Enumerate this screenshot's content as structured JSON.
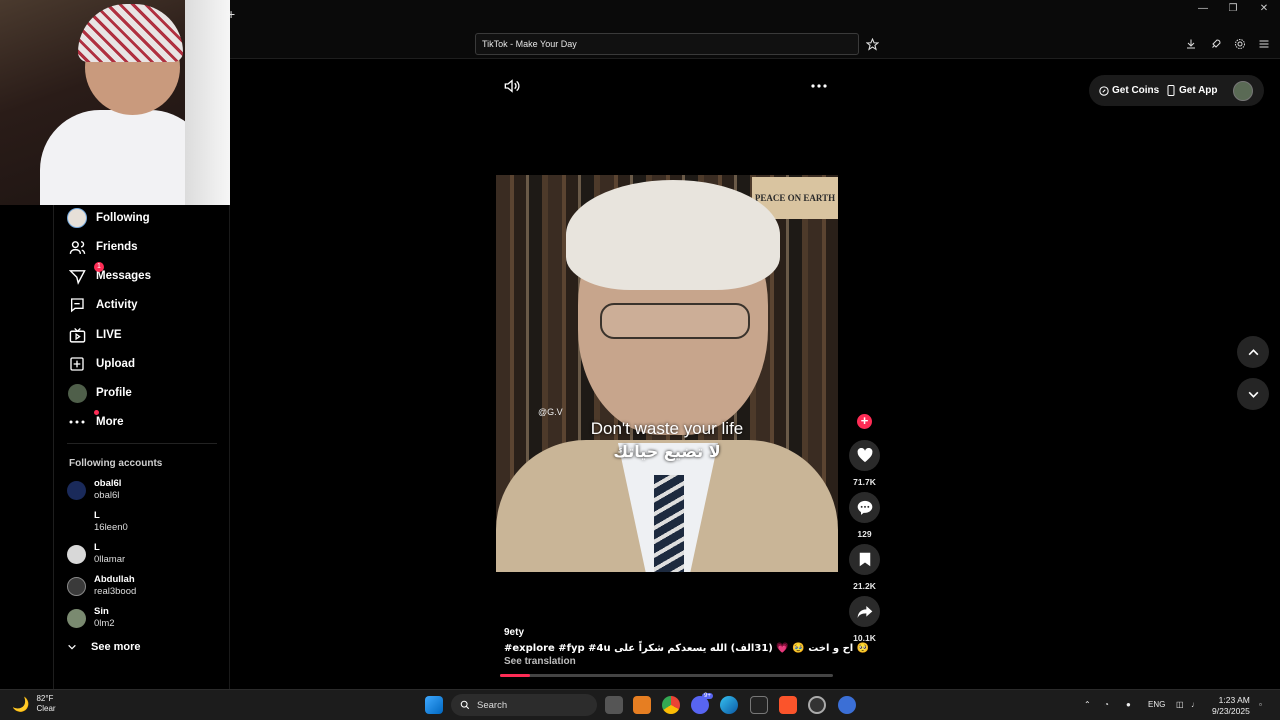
{
  "browser": {
    "tab_title": "TikTok - Make Your Day",
    "new_tab_glyph": "+",
    "toolbar_icons": [
      "bookmark-star-icon",
      "download-icon",
      "rocket-icon",
      "settings-icon",
      "menu-icon"
    ],
    "window_controls": [
      "minimize",
      "restore",
      "close"
    ]
  },
  "sidebar": {
    "items": [
      {
        "label": "Following",
        "icon": "following-avatar-icon"
      },
      {
        "label": "Friends",
        "icon": "friends-icon"
      },
      {
        "label": "Messages",
        "icon": "messages-icon",
        "badge": "1"
      },
      {
        "label": "Activity",
        "icon": "activity-icon"
      },
      {
        "label": "LIVE",
        "icon": "live-icon"
      },
      {
        "label": "Upload",
        "icon": "upload-icon"
      },
      {
        "label": "Profile",
        "icon": "profile-avatar-icon"
      },
      {
        "label": "More",
        "icon": "more-dots-icon"
      }
    ],
    "following_title": "Following accounts",
    "accounts": [
      {
        "name": "obal6l",
        "handle": "obal6l",
        "avatar_color": "#1a2a5a"
      },
      {
        "name": "L",
        "handle": "16leen0",
        "avatar_color": "#000000"
      },
      {
        "name": "L",
        "handle": "0llamar",
        "avatar_color": "#d8d8d8"
      },
      {
        "name": "Abdullah",
        "handle": "real3bood",
        "avatar_color": "#3a3a3a"
      },
      {
        "name": "Sin",
        "handle": "0lm2",
        "avatar_color": "#7a8a70"
      }
    ],
    "see_more": "See more"
  },
  "video": {
    "poster_text": "PEACE ON EARTH",
    "watermark": "@G.V",
    "caption_en": "Don't waste your life",
    "caption_ar": "لا تضيع حياتك",
    "author": "9ety",
    "description": "#explore  #fyp  #4u  اح و اخت 🥹 💗 (31الف) الله يسعدكم شكراً على 🥺",
    "see_translation": "See translation",
    "progress": 0.09
  },
  "actions": {
    "likes": "71.7K",
    "comments": "129",
    "saves": "21.2K",
    "shares": "10.1K"
  },
  "header_right": {
    "get_coins": "Get Coins",
    "get_app": "Get App"
  },
  "taskbar": {
    "weather_temp": "82°F",
    "weather_desc": "Clear",
    "search_label": "Search",
    "lang": "ENG",
    "time": "1:23 AM",
    "date": "9/23/2025",
    "discord_badge": "9+"
  },
  "colors": {
    "accent": "#fe2c55",
    "background": "#000000"
  }
}
